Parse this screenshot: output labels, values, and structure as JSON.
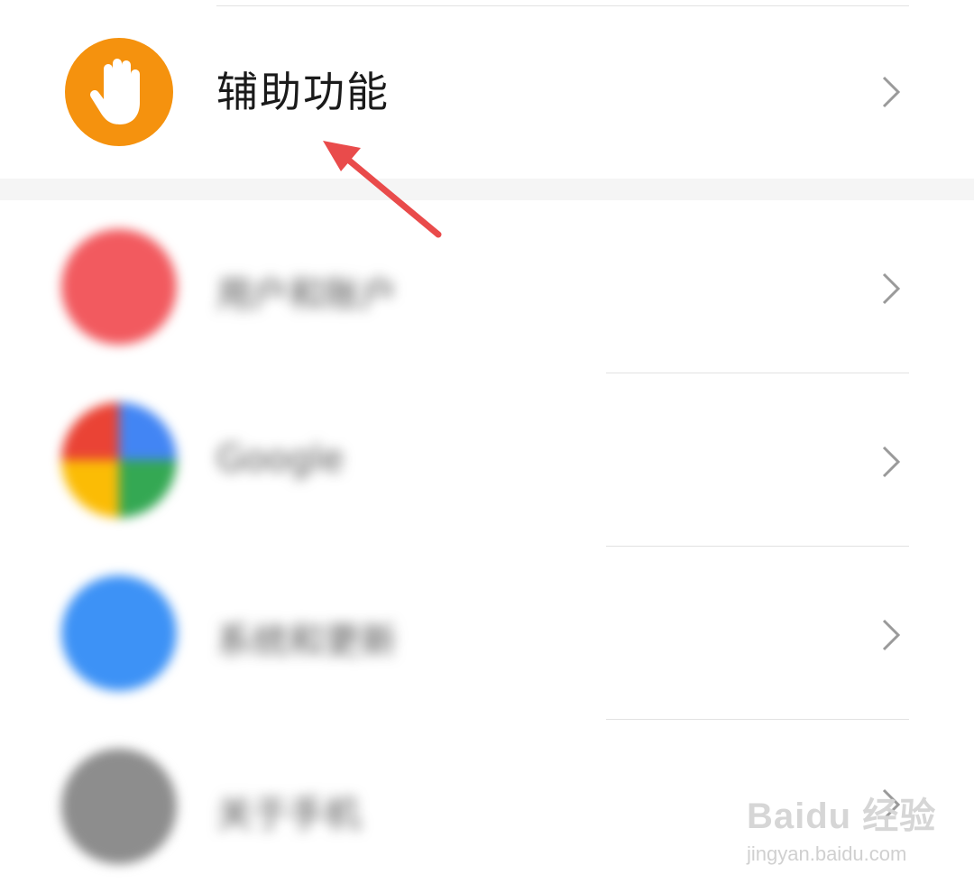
{
  "accessibility_item": {
    "label": "辅助功能",
    "icon": "hand-icon",
    "icon_color": "#f5920e"
  },
  "blurred_items": [
    {
      "icon": "user-icon",
      "icon_color": "#f25a5f",
      "label": "用户和账户"
    },
    {
      "icon": "google-icon",
      "icon_color": "#4285f4",
      "label": "Google"
    },
    {
      "icon": "clock-icon",
      "icon_color": "#3d92f6",
      "label": "系统和更新"
    },
    {
      "icon": "info-icon",
      "icon_color": "#8d8d8d",
      "label": "关于手机"
    }
  ],
  "annotation": {
    "type": "arrow",
    "color": "#e94b4b",
    "points_to": "accessibility_item"
  },
  "watermark": {
    "brand": "Baidu 经验",
    "url": "jingyan.baidu.com"
  }
}
